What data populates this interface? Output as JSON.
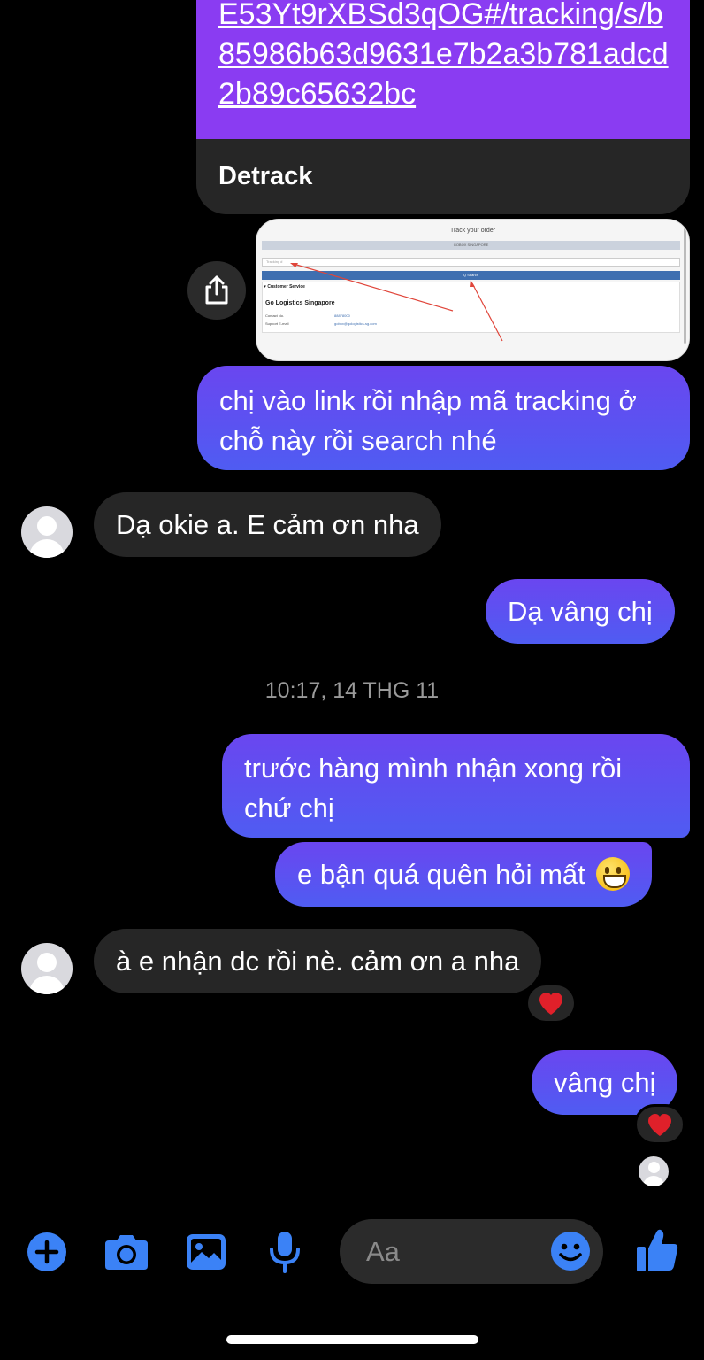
{
  "link_preview": {
    "url_text": "E53Yt9rXBSd3qOG#/tracking/s/b85986b63d9631e7b2a3b781adcd2b89c65632bc",
    "site_name": "Detrack"
  },
  "screenshot": {
    "title": "Track your order",
    "band_text": "GOBOX SINGAPORE",
    "input_placeholder": "Tracking #",
    "search_label": "Q Search",
    "customer_service": "♥ Customer Service",
    "company": "Go Logistics Singapore",
    "contact_label": "Contact No.",
    "contact_value": "88878000",
    "email_label": "Support E-mail",
    "email_value": "gobox@gologistics-sg.com"
  },
  "messages": [
    {
      "side": "out",
      "text": "chị vào link rồi nhập mã tracking ở chỗ này rồi search nhé"
    },
    {
      "side": "in",
      "text": "Dạ okie a. E  cảm ơn nha"
    },
    {
      "side": "out",
      "text": "Dạ vâng chị"
    },
    {
      "side": "out",
      "text": "trước hàng mình nhận xong rồi chứ chị"
    },
    {
      "side": "out",
      "text": "e bận quá quên hỏi mất",
      "emoji": "grinning-face"
    },
    {
      "side": "in",
      "text": "à e nhận dc rồi nè. cảm ơn a nha",
      "reaction": "red-heart"
    },
    {
      "side": "out",
      "text": "vâng chị",
      "reaction": "red-heart"
    }
  ],
  "timestamp": "10:17, 14 THG 11",
  "composer": {
    "placeholder": "Aa",
    "icons": [
      "plus-icon",
      "camera-icon",
      "gallery-icon",
      "microphone-icon",
      "emoji-icon",
      "thumbs-up-icon"
    ]
  },
  "colors": {
    "accent": "#4f5cf2",
    "outgoing_top": "#6a46f0",
    "link_purple": "#8a3cf2",
    "incoming": "#262626",
    "icon_blue": "#3b82f6",
    "heart": "#e0202a"
  }
}
